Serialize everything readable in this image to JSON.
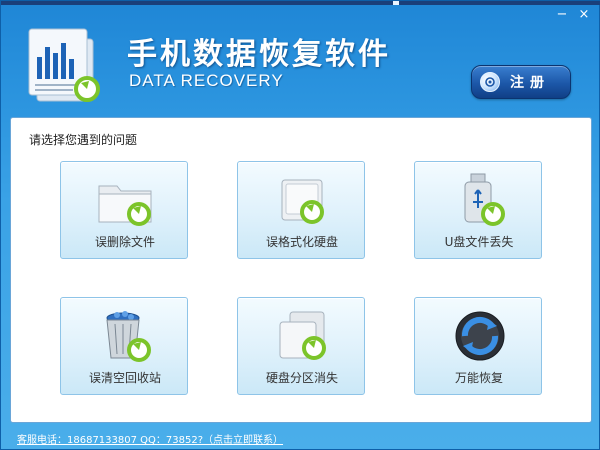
{
  "window": {
    "title": "手机数据恢复软件",
    "subtitle": "DATA RECOVERY",
    "minimize_glyph": "−",
    "close_glyph": "×"
  },
  "header": {
    "register_label": "注册",
    "register_icon": "shield-gear-icon",
    "logo_icon": "document-bar-chart-icon"
  },
  "main": {
    "prompt": "请选择您遇到的问题",
    "tiles": [
      {
        "label": "误删除文件",
        "icon": "folder-icon"
      },
      {
        "label": "误格式化硬盘",
        "icon": "hard-drive-icon"
      },
      {
        "label": "U盘文件丢失",
        "icon": "usb-drive-icon"
      },
      {
        "label": "误清空回收站",
        "icon": "recycle-bin-icon"
      },
      {
        "label": "硬盘分区消失",
        "icon": "disk-partition-icon"
      },
      {
        "label": "万能恢复",
        "icon": "universal-recovery-icon"
      }
    ]
  },
  "footer": {
    "contact": "客服电话：18687133807 QQ：73852?（点击立即联系）"
  },
  "colors": {
    "title_bar": "#1f86d6",
    "tile_border": "#8ec4e8",
    "recovery_arrow": "#7cc42a"
  }
}
